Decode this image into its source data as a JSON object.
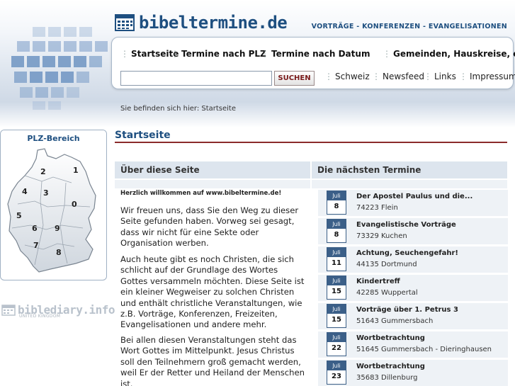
{
  "brand": {
    "title": "bibeltermine.de",
    "tagline": "VORTRÄGE - KONFERENZEN - EVANGELISATIONEN"
  },
  "nav": {
    "main": [
      "Startseite",
      "Termine nach PLZ",
      "Termine nach Datum",
      "Gemeinden, Hauskreise, etc."
    ],
    "secondary": [
      "Schweiz",
      "Newsfeed",
      "Links",
      "Impressum"
    ],
    "search_button": "SUCHEN",
    "search_value": ""
  },
  "breadcrumb": "Sie befinden sich hier: Startseite",
  "sidebar": {
    "plz_title": "PLZ-Bereich",
    "plz_regions": [
      "2",
      "1",
      "4",
      "3",
      "0",
      "5",
      "6",
      "9",
      "7",
      "8"
    ],
    "partner_name": "biblediary.info",
    "partner_sub": "UNITED KINGDOM"
  },
  "main": {
    "title": "Startseite",
    "about_heading": "Über diese Seite",
    "dates_heading": "Die nächsten Termine",
    "welcome": "Herzlich willkommen auf www.bibeltermine.de!",
    "paragraphs": [
      "Wir freuen uns, dass Sie den Weg zu dieser Seite gefunden haben. Vorweg sei gesagt, dass wir nicht für eine Sekte oder Organisation werben.",
      "Auch heute gibt es noch Christen, die sich schlicht auf der Grundlage des Wortes Gottes versammeln möchten. Diese Seite ist ein kleiner Wegweiser zu solchen Christen und enthält christliche Veranstaltungen, wie z.B. Vorträge, Konferenzen, Freizeiten, Evangelisationen und andere mehr.",
      "Bei allen diesen Veranstaltungen steht das Wort Gottes im Mittelpunkt. Jesus Christus soll den Teilnehmern groß gemacht werden, weil Er der Retter und Heiland der Menschen ist."
    ]
  },
  "events": [
    {
      "month": "Juli",
      "day": "8",
      "title": "Der Apostel Paulus und die...",
      "place": "74223 Flein"
    },
    {
      "month": "Juli",
      "day": "8",
      "title": "Evangelistische Vorträge",
      "place": "73329 Kuchen"
    },
    {
      "month": "Juli",
      "day": "11",
      "title": "Achtung, Seuchengefahr!",
      "place": "44135 Dortmund"
    },
    {
      "month": "Juli",
      "day": "15",
      "title": "Kindertreff",
      "place": "42285 Wuppertal"
    },
    {
      "month": "Juli",
      "day": "15",
      "title": "Vorträge über 1. Petrus 3",
      "place": "51643 Gummersbach"
    },
    {
      "month": "Juli",
      "day": "22",
      "title": "Wortbetrachtung",
      "place": "51645 Gummersbach - Dieringhausen"
    },
    {
      "month": "Juli",
      "day": "23",
      "title": "Wortbetrachtung",
      "place": "35683 Dillenburg"
    }
  ],
  "colors": {
    "brand_blue": "#1e4f80",
    "rule_red": "#8b2b2b",
    "head_bg": "#dde5ee",
    "event_bg": "#eef2f6"
  }
}
